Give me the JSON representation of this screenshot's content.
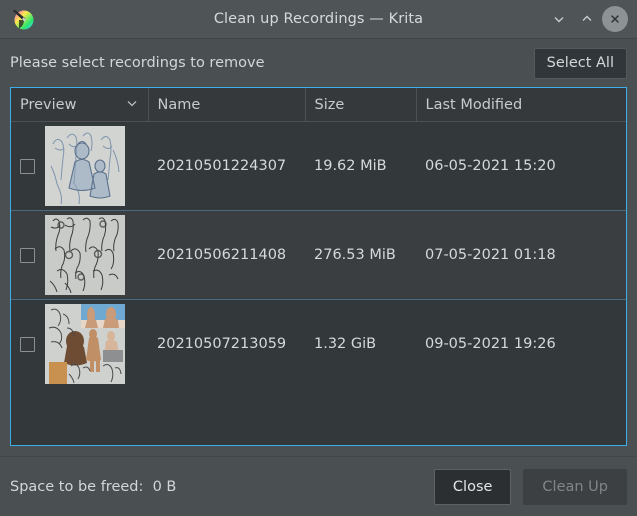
{
  "window": {
    "title": "Clean up Recordings — Krita",
    "app_icon": "krita-logo-icon",
    "minimize_label": "Minimize",
    "maximize_label": "Maximize",
    "close_label": "Close"
  },
  "prompt": {
    "text": "Please select recordings to remove",
    "select_all_label": "Select All"
  },
  "table": {
    "columns": [
      {
        "key": "preview",
        "label": "Preview",
        "sort_indicator": "chevron-down-icon"
      },
      {
        "key": "name",
        "label": "Name"
      },
      {
        "key": "size",
        "label": "Size"
      },
      {
        "key": "modified",
        "label": "Last Modified"
      }
    ],
    "rows": [
      {
        "checked": false,
        "preview_alt": "character-sketches-thumbnail",
        "name": "20210501224307",
        "size": "19.62 MiB",
        "modified": "06-05-2021 15:20"
      },
      {
        "checked": false,
        "preview_alt": "gesture-figure-sketches-thumbnail",
        "name": "20210506211408",
        "size": "276.53 MiB",
        "modified": "07-05-2021 01:18"
      },
      {
        "checked": false,
        "preview_alt": "color-figure-studies-thumbnail",
        "name": "20210507213059",
        "size": "1.32 GiB",
        "modified": "09-05-2021 19:26"
      }
    ]
  },
  "footer": {
    "space_label": "Space to be freed:",
    "space_value": "0 B",
    "close_label": "Close",
    "cleanup_label": "Clean Up"
  },
  "colors": {
    "window_bg": "#4a4f52",
    "titlebar_bg": "#4f5457",
    "table_bg": "#33383b",
    "row_alt_bg": "#3a3e41",
    "focus_border": "#3daee9",
    "text": "#d6d9da",
    "disabled_text": "#808588"
  }
}
